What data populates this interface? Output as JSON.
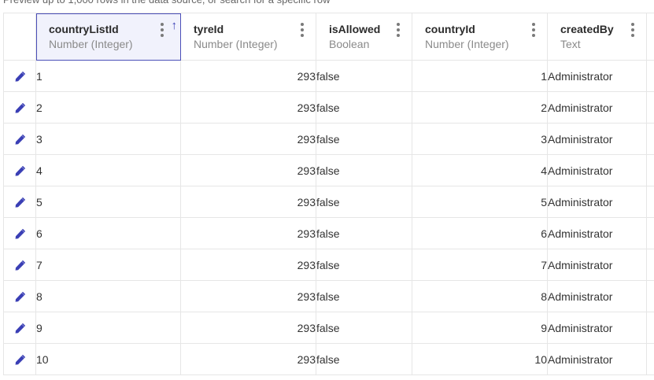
{
  "preview_note": "Preview up to 1,000 rows in the data source, or search for a specific row",
  "colors": {
    "accent": "#3a3fb5",
    "sorted_header_bg": "#f1f2fc",
    "grid_line": "#e6e6e6"
  },
  "columns": [
    {
      "name": "countryListId",
      "type": "Number (Integer)",
      "sorted": "ascending",
      "sort_icon": "arrow-up-icon"
    },
    {
      "name": "tyreId",
      "type": "Number (Integer)"
    },
    {
      "name": "isAllowed",
      "type": "Boolean"
    },
    {
      "name": "countryId",
      "type": "Number (Integer)"
    },
    {
      "name": "createdBy",
      "type": "Text"
    }
  ],
  "sort_arrow": "↑",
  "edit_icon": "pencil-icon",
  "rows": [
    {
      "countryListId": "1",
      "tyreId": "293",
      "isAllowed": "false",
      "countryId": "1",
      "createdBy": "Administrator"
    },
    {
      "countryListId": "2",
      "tyreId": "293",
      "isAllowed": "false",
      "countryId": "2",
      "createdBy": "Administrator"
    },
    {
      "countryListId": "3",
      "tyreId": "293",
      "isAllowed": "false",
      "countryId": "3",
      "createdBy": "Administrator"
    },
    {
      "countryListId": "4",
      "tyreId": "293",
      "isAllowed": "false",
      "countryId": "4",
      "createdBy": "Administrator"
    },
    {
      "countryListId": "5",
      "tyreId": "293",
      "isAllowed": "false",
      "countryId": "5",
      "createdBy": "Administrator"
    },
    {
      "countryListId": "6",
      "tyreId": "293",
      "isAllowed": "false",
      "countryId": "6",
      "createdBy": "Administrator"
    },
    {
      "countryListId": "7",
      "tyreId": "293",
      "isAllowed": "false",
      "countryId": "7",
      "createdBy": "Administrator"
    },
    {
      "countryListId": "8",
      "tyreId": "293",
      "isAllowed": "false",
      "countryId": "8",
      "createdBy": "Administrator"
    },
    {
      "countryListId": "9",
      "tyreId": "293",
      "isAllowed": "false",
      "countryId": "9",
      "createdBy": "Administrator"
    },
    {
      "countryListId": "10",
      "tyreId": "293",
      "isAllowed": "false",
      "countryId": "10",
      "createdBy": "Administrator"
    }
  ]
}
